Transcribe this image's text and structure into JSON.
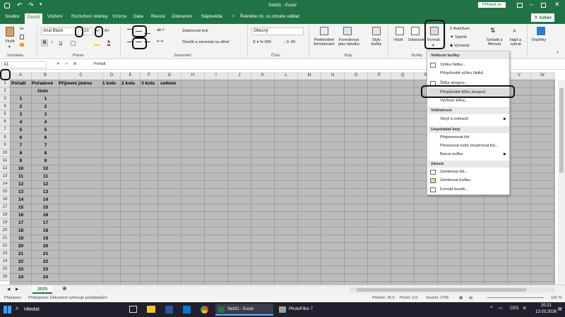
{
  "title_bar": {
    "window_title": "Sešit1 - Excel",
    "search_placeholder": "Hledat",
    "signin_label": "Přihlásit se"
  },
  "tabs": [
    "Soubor",
    "Domů",
    "Vložení",
    "Rozložení stránky",
    "Vzorce",
    "Data",
    "Revize",
    "Zobrazení",
    "Nápověda"
  ],
  "active_tab": "Domů",
  "tell_me": "Řekněte mi, co chcete udělat",
  "share_label": "Sdílet",
  "ribbon": {
    "paste_label": "Vložit",
    "clipboard_group": "Schránka",
    "font_name": "Arial Black",
    "font_size": "10",
    "font_group": "Písmo",
    "bold": "B",
    "italic": "I",
    "underline": "U",
    "wrap_text": "Zalamovat text",
    "merge_center": "Sloučit a zarovnat na střed",
    "alignment_group": "Zarovnání",
    "number_format": "Obecný",
    "number_group": "Číslo",
    "cond_format": "Podmíněné formátování",
    "format_table": "Formátovat jako tabulku",
    "cell_styles": "Styly buňky",
    "styles_group": "Styly",
    "insert_label": "Vložit",
    "delete_label": "Odstranit",
    "format_label": "Formát",
    "cells_group": "Buňky",
    "autosum": "AutoSum",
    "fill": "Vyplnit",
    "clear": "Vymazat",
    "sort_filter": "Seřadit a filtrovat",
    "find_select": "Najít a vybrat",
    "addins": "Doplňky"
  },
  "formula_bar": {
    "name_box": "A1",
    "fx": "fx",
    "content": "Pořadí"
  },
  "columns": [
    "A",
    "B",
    "C",
    "D",
    "E",
    "F",
    "G",
    "H",
    "I",
    "J",
    "K",
    "L",
    "M",
    "N",
    "O",
    "P",
    "Q",
    "R",
    "S",
    "T",
    "U",
    "V",
    "W"
  ],
  "sheet": {
    "header_row": [
      "Pořadí",
      "Pořadové",
      "Příjmení jméno",
      "1 kolo",
      "2 kolo",
      "3 kolo",
      "celkem"
    ],
    "header_row2": "číslo",
    "row_numbers": [
      "1",
      "2",
      "3",
      "4",
      "5",
      "6",
      "7",
      "8",
      "9",
      "10",
      "11",
      "12",
      "13",
      "14",
      "15",
      "16",
      "17",
      "18",
      "19",
      "20",
      "21",
      "22",
      "23",
      "24",
      "25",
      "26"
    ],
    "col_a": [
      "1",
      "2",
      "3",
      "4",
      "5",
      "6",
      "7",
      "8",
      "9",
      "10",
      "11",
      "12",
      "13",
      "14",
      "15",
      "16",
      "17",
      "18",
      "19",
      "20",
      "21",
      "22",
      "23",
      "24"
    ],
    "col_b": [
      "1",
      "2",
      "3",
      "4",
      "5",
      "6",
      "7",
      "8",
      "9",
      "10",
      "11",
      "12",
      "13",
      "14",
      "15",
      "16",
      "17",
      "18",
      "19",
      "20",
      "21",
      "22",
      "23",
      "24"
    ]
  },
  "format_menu": {
    "cell_size_header": "Velikost buňky",
    "row_height": "Výška řádku...",
    "autofit_row": "Přizpůsobit výšku řádků",
    "col_width": "Šířka sloupce...",
    "autofit_col": "Přizpůsobit šířku sloupců",
    "default_width": "Výchozí šířka...",
    "visibility_header": "Viditelnost",
    "hide_unhide": "Skrýt a zobrazit",
    "organize_header": "Uspořádat listy",
    "rename_sheet": "Přejmenovat list",
    "move_copy": "Přesunout nebo zkopírovat list...",
    "tab_color": "Barva ouška",
    "protection_header": "Zámek",
    "protect_sheet": "Zamknout list...",
    "lock_cell": "Zamknout buňku",
    "format_cells": "Formát buněk..."
  },
  "sheet_tab": "2025",
  "status": {
    "ready": "Připraven",
    "accessibility": "Přístupnost: Dokument vyhovuje požadavkům",
    "average": "Průměr: 26,5",
    "count": "Počet: 112",
    "sum": "Součet: 2756",
    "zoom": "100 %"
  },
  "taskbar": {
    "search": "Hledat",
    "excel_app": "Sešit1 - Excel",
    "photofiltre": "PhotoFiltre 7",
    "lang": "CES",
    "time": "20:21",
    "date": "13.03.2026"
  },
  "colors": {
    "excel_green": "#217346",
    "grid_gray": "#bcbcbc",
    "taskbar": "#1f1f2e"
  }
}
